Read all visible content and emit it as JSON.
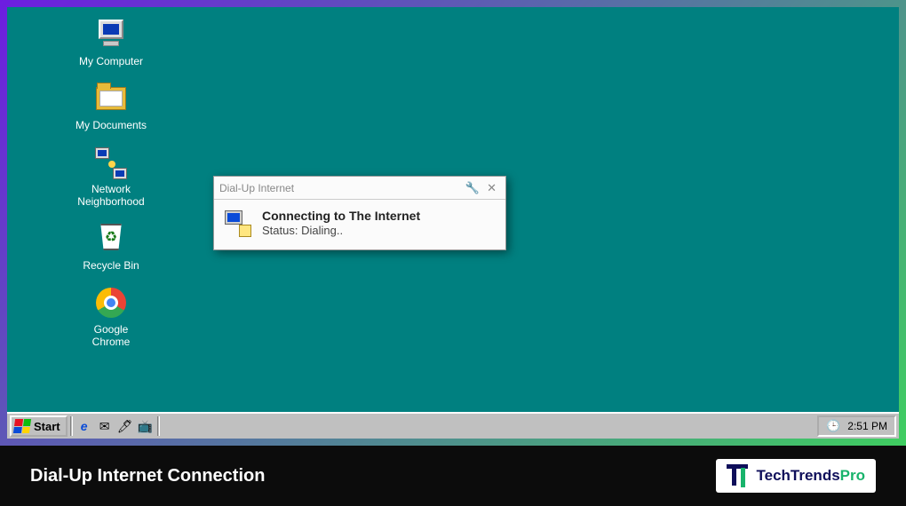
{
  "desktop": {
    "icons": [
      {
        "id": "my-computer",
        "label": "My Computer"
      },
      {
        "id": "my-documents",
        "label": "My Documents"
      },
      {
        "id": "network-neighborhood",
        "label": "Network\nNeighborhood"
      },
      {
        "id": "recycle-bin",
        "label": "Recycle Bin"
      },
      {
        "id": "google-chrome",
        "label": "Google\nChrome"
      }
    ]
  },
  "dialog": {
    "title": "Dial-Up Internet",
    "heading": "Connecting to The Internet",
    "status_label": "Status:",
    "status_value": "Dialing.."
  },
  "taskbar": {
    "start_label": "Start",
    "quicklaunch": [
      {
        "id": "ie",
        "glyph": "e"
      },
      {
        "id": "outlook",
        "glyph": "✉"
      },
      {
        "id": "desktop",
        "glyph": "🖊"
      },
      {
        "id": "channels",
        "glyph": "📺"
      }
    ],
    "tray": {
      "icons": [
        {
          "id": "scheduler",
          "glyph": "🕒"
        }
      ],
      "clock": "2:51 PM"
    }
  },
  "caption": {
    "text": "Dial-Up Internet Connection",
    "brand_a": "TechTrends",
    "brand_b": "Pro"
  }
}
